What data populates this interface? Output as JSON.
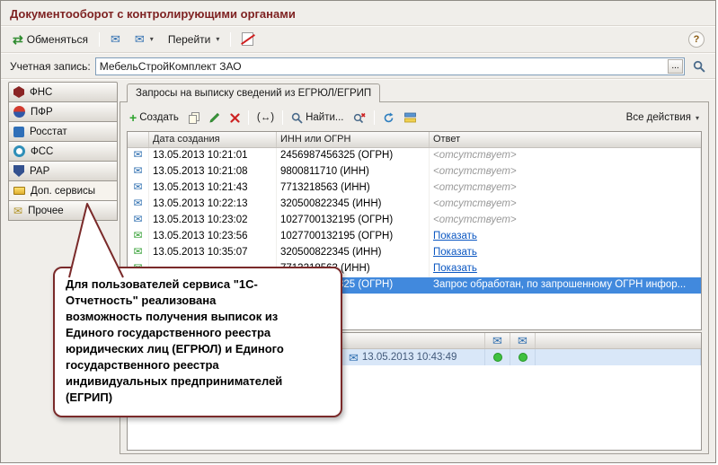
{
  "window": {
    "title": "Документооборот с контролирующими органами",
    "help_label": "?"
  },
  "top_toolbar": {
    "exchange_label": "Обменяться",
    "goto_label": "Перейти",
    "goto_arrow": "▾"
  },
  "account": {
    "label": "Учетная запись:",
    "value": "МебельСтройКомплект ЗАО",
    "select_label": "..."
  },
  "sidebar": {
    "items": [
      "ФНС",
      "ПФР",
      "Росстат",
      "ФСС",
      "РАР",
      "Доп. сервисы",
      "Прочее"
    ],
    "active_item": "Доп. сервисы"
  },
  "content": {
    "tab_label": "Запросы на выписку сведений из ЕГРЮЛ/ЕГРИП",
    "toolbar": {
      "create_label": "Создать",
      "link_label": "(↔)",
      "find_label": "Найти...",
      "all_actions_label": "Все действия",
      "all_actions_arrow": "▾"
    },
    "table": {
      "columns": [
        "Дата создания",
        "ИНН или ОГРН",
        "Ответ"
      ],
      "rows": [
        {
          "date": "13.05.2013 10:21:01",
          "id": "2456987456325 (ОГРН)",
          "answer": "<отсутствует>"
        },
        {
          "date": "13.05.2013 10:21:08",
          "id": "9800811710 (ИНН)",
          "answer": "<отсутствует>"
        },
        {
          "date": "13.05.2013 10:21:43",
          "id": "7713218563 (ИНН)",
          "answer": "<отсутствует>"
        },
        {
          "date": "13.05.2013 10:22:13",
          "id": "320500822345 (ИНН)",
          "answer": "<отсутствует>"
        },
        {
          "date": "13.05.2013 10:23:02",
          "id": "1027700132195 (ОГРН)",
          "answer": "<отсутствует>"
        },
        {
          "date": "13.05.2013 10:23:56",
          "id": "1027700132195 (ОГРН)",
          "answer": "Показать"
        },
        {
          "date": "13.05.2013 10:35:07",
          "id": "320500822345 (ИНН)",
          "answer": "Показать"
        },
        {
          "date": "",
          "id": "7713218563 (ИНН)",
          "answer": "Показать"
        },
        {
          "date": "",
          "id": "2456987456325 (ОГРН)",
          "answer": "Запрос обработан, по запрошенному ОГРН инфор..."
        }
      ]
    },
    "bottom": {
      "row_date": "13.05.2013 10:43:49"
    }
  },
  "callout": {
    "text": "Для пользователей сервиса \"1С-\nОтчетность\" реализована\nвозможность получения выписок из\nЕдиного государственного реестра\nюридических лиц (ЕГРЮЛ) и Единого\nгосударственного реестра\nиндивидуальных предпринимателей\n(ЕГРИП)"
  },
  "colors": {
    "title_accent": "#7e2222",
    "selection_blue": "#4189dd",
    "link_blue": "#0b57c2",
    "callout_border": "#7a2a2a",
    "status_green": "#3fc13f"
  }
}
